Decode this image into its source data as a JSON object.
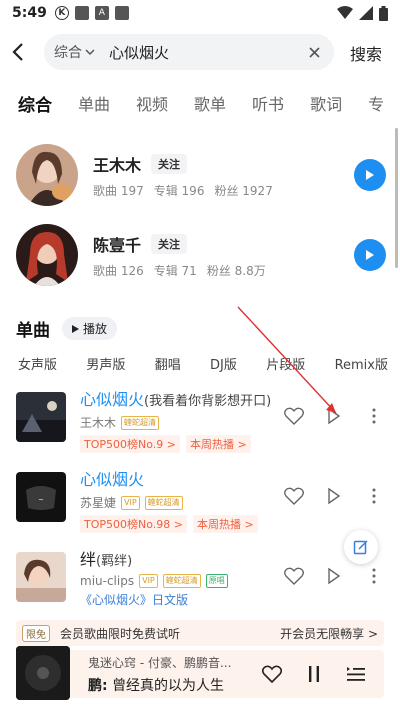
{
  "status": {
    "time": "5:49"
  },
  "search": {
    "category": "综合",
    "query": "心似烟火",
    "submit": "搜索"
  },
  "tabs": [
    "综合",
    "单曲",
    "视频",
    "歌单",
    "听书",
    "歌词",
    "专"
  ],
  "artists": [
    {
      "name": "王木木",
      "follow": "关注",
      "songs": "歌曲 197",
      "albums": "专辑 196",
      "fans": "粉丝 1927"
    },
    {
      "name": "陈壹千",
      "follow": "关注",
      "songs": "歌曲 126",
      "albums": "专辑 71",
      "fans": "粉丝 8.8万"
    }
  ],
  "singles": {
    "title": "单曲",
    "play_all": "播放"
  },
  "filters": [
    "女声版",
    "男声版",
    "翻唱",
    "DJ版",
    "片段版",
    "Remix版"
  ],
  "songs": [
    {
      "title": "心似烟火",
      "subtitle": "(我看着你背影想开口)",
      "artist": "王木木",
      "badges": [
        "蝰蛇超清"
      ],
      "tags": [
        "TOP500榜No.9 >",
        "本周热播 >"
      ]
    },
    {
      "title": "心似烟火",
      "subtitle": "",
      "artist": "苏星婕",
      "badges": [
        "VIP",
        "蝰蛇超清"
      ],
      "tags": [
        "TOP500榜No.98 >",
        "本周热播 >"
      ]
    },
    {
      "title": "绊",
      "subtitle": "(羁绊)",
      "artist": "miu-clips",
      "badges": [
        "VIP",
        "蝰蛇超清",
        "原唱"
      ],
      "extra": "《心似烟火》日文版"
    }
  ],
  "vip_banner": {
    "label": "限免",
    "text": "会员歌曲限时免费试听",
    "cta": "开会员无限畅享 >"
  },
  "player": {
    "line1": "鬼迷心窍 - 付豪、鹏鹏音...",
    "line2_bold": "鹏:",
    "line2": "曾经真的以为人生"
  },
  "colors": {
    "accent": "#1e8ff0",
    "tag": "#f06040"
  }
}
